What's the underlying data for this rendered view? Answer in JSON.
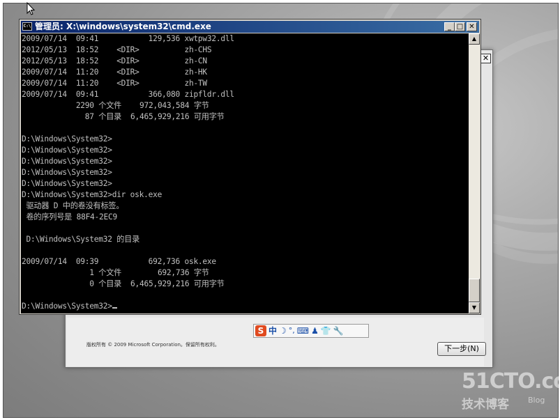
{
  "setup_dialog": {
    "copyright": "版权所有 © 2009 Microsoft Corporation。保留所有权利。",
    "next_button": "下一步(N)",
    "close_glyph": "✕"
  },
  "ime_toolbar": {
    "logo": "S",
    "mode": "中",
    "half_full": "☽",
    "punct": "°,",
    "keyboard": "⌨",
    "user": "♟",
    "skin": "👕",
    "tools": "🔧"
  },
  "cmd_window": {
    "title": "管理员: X:\\windows\\system32\\cmd.exe",
    "sys_icon": "C:\\",
    "minimize": "_",
    "maximize": "□",
    "close": "✕",
    "lines": [
      "2009/07/14  09:41           129,536 xwtpw32.dll",
      "2012/05/13  18:52    <DIR>          zh-CHS",
      "2012/05/13  18:52    <DIR>          zh-CN",
      "2009/07/14  11:20    <DIR>          zh-HK",
      "2009/07/14  11:20    <DIR>          zh-TW",
      "2009/07/14  09:41           366,080 zipfldr.dll",
      "            2290 个文件    972,043,584 字节",
      "              87 个目录  6,465,929,216 可用字节",
      "",
      "D:\\Windows\\System32>",
      "D:\\Windows\\System32>",
      "D:\\Windows\\System32>",
      "D:\\Windows\\System32>",
      "D:\\Windows\\System32>",
      "D:\\Windows\\System32>dir osk.exe",
      " 驱动器 D 中的卷没有标签。",
      " 卷的序列号是 88F4-2EC9",
      "",
      " D:\\Windows\\System32 的目录",
      "",
      "2009/07/14  09:39           692,736 osk.exe",
      "               1 个文件        692,736 字节",
      "               0 个目录  6,465,929,216 可用字节",
      "",
      "D:\\Windows\\System32>"
    ],
    "scroll_up": "▲",
    "scroll_down": "▼"
  },
  "watermark": {
    "line1": "51CTO.com",
    "line2": "技术博客",
    "line3": "Blog"
  },
  "colors": {
    "title_bar_start": "#0a246a",
    "title_bar_end": "#3a6ea5",
    "console_bg": "#000000",
    "console_fg": "#c0c0c0"
  }
}
